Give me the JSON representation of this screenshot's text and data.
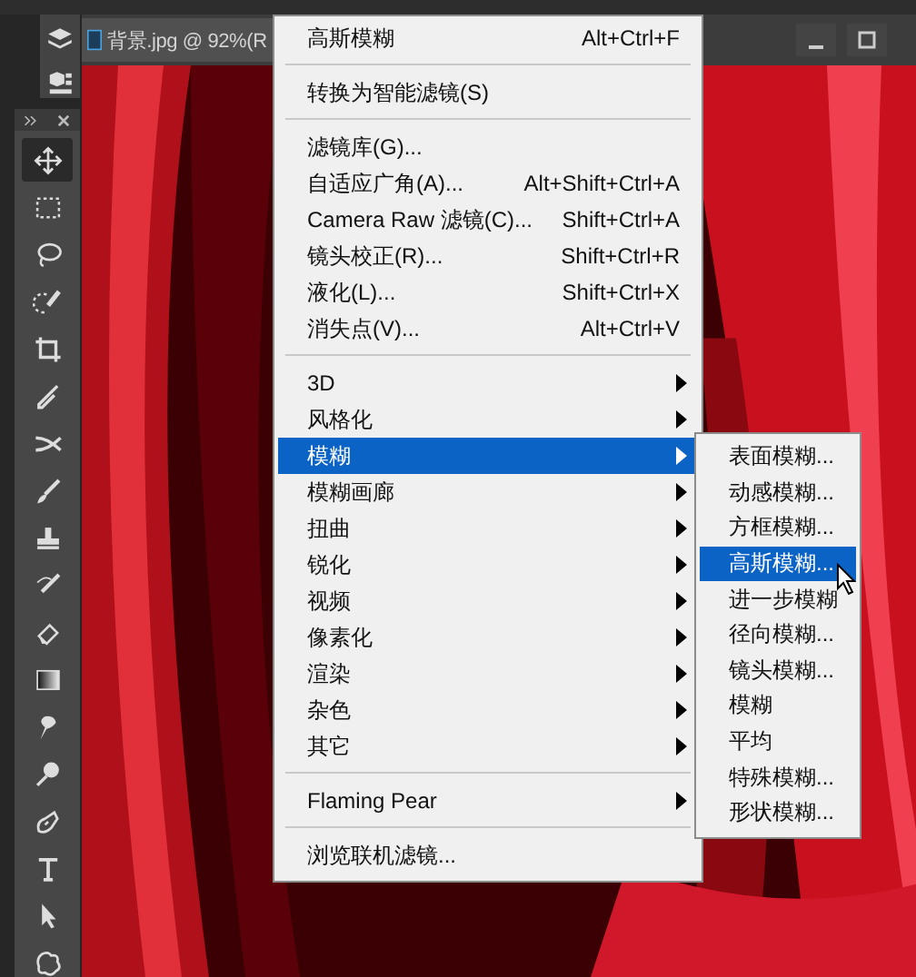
{
  "document_tab": {
    "title": "背景.jpg @ 92%(R"
  },
  "toolbar": {
    "tools": [
      {
        "selected": true
      },
      {
        "selected": false
      },
      {
        "selected": false
      },
      {
        "selected": false
      },
      {
        "selected": false
      },
      {
        "selected": false
      },
      {
        "selected": false
      },
      {
        "selected": false
      },
      {
        "selected": false
      },
      {
        "selected": false
      },
      {
        "selected": false
      },
      {
        "selected": false
      },
      {
        "selected": false
      },
      {
        "selected": false
      },
      {
        "selected": false
      },
      {
        "selected": false
      },
      {
        "selected": false
      },
      {
        "selected": false
      }
    ]
  },
  "filter_menu": {
    "sections": [
      [
        {
          "label": "高斯模糊",
          "shortcut": "Alt+Ctrl+F",
          "submenu": false,
          "selected": false
        }
      ],
      [
        {
          "label": "转换为智能滤镜(S)",
          "submenu": false,
          "selected": false
        }
      ],
      [
        {
          "label": "滤镜库(G)...",
          "submenu": false,
          "selected": false
        },
        {
          "label": "自适应广角(A)...",
          "shortcut": "Alt+Shift+Ctrl+A",
          "submenu": false,
          "selected": false
        },
        {
          "label": "Camera Raw 滤镜(C)...",
          "shortcut": "Shift+Ctrl+A",
          "submenu": false,
          "selected": false
        },
        {
          "label": "镜头校正(R)...",
          "shortcut": "Shift+Ctrl+R",
          "submenu": false,
          "selected": false
        },
        {
          "label": "液化(L)...",
          "shortcut": "Shift+Ctrl+X",
          "submenu": false,
          "selected": false
        },
        {
          "label": "消失点(V)...",
          "shortcut": "Alt+Ctrl+V",
          "submenu": false,
          "selected": false
        }
      ],
      [
        {
          "label": "3D",
          "submenu": true,
          "selected": false
        },
        {
          "label": "风格化",
          "submenu": true,
          "selected": false
        },
        {
          "label": "模糊",
          "submenu": true,
          "selected": true
        },
        {
          "label": "模糊画廊",
          "submenu": true,
          "selected": false
        },
        {
          "label": "扭曲",
          "submenu": true,
          "selected": false
        },
        {
          "label": "锐化",
          "submenu": true,
          "selected": false
        },
        {
          "label": "视频",
          "submenu": true,
          "selected": false
        },
        {
          "label": "像素化",
          "submenu": true,
          "selected": false
        },
        {
          "label": "渲染",
          "submenu": true,
          "selected": false
        },
        {
          "label": "杂色",
          "submenu": true,
          "selected": false
        },
        {
          "label": "其它",
          "submenu": true,
          "selected": false
        }
      ],
      [
        {
          "label": "Flaming Pear",
          "submenu": true,
          "selected": false
        }
      ],
      [
        {
          "label": "浏览联机滤镜...",
          "submenu": false,
          "selected": false
        }
      ]
    ]
  },
  "blur_submenu": {
    "items": [
      {
        "label": "表面模糊...",
        "selected": false
      },
      {
        "label": "动感模糊...",
        "selected": false
      },
      {
        "label": "方框模糊...",
        "selected": false
      },
      {
        "label": "高斯模糊...",
        "selected": true
      },
      {
        "label": "进一步模糊",
        "selected": false
      },
      {
        "label": "径向模糊...",
        "selected": false
      },
      {
        "label": "镜头模糊...",
        "selected": false
      },
      {
        "label": "模糊",
        "selected": false
      },
      {
        "label": "平均",
        "selected": false
      },
      {
        "label": "特殊模糊...",
        "selected": false
      },
      {
        "label": "形状模糊...",
        "selected": false
      }
    ]
  }
}
